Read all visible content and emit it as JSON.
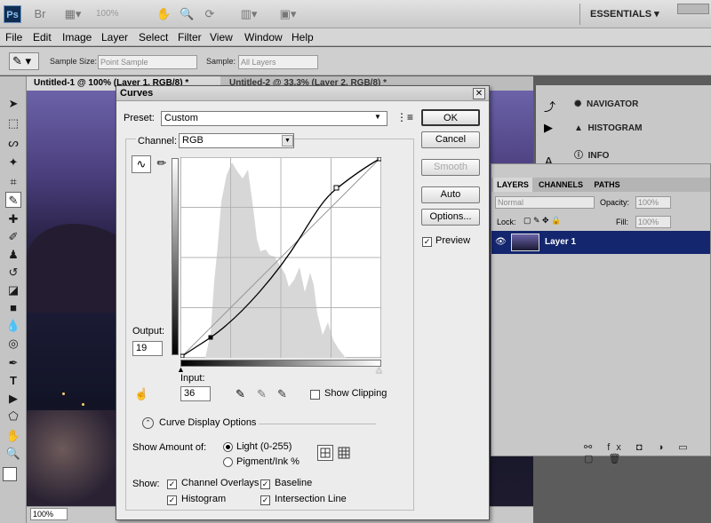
{
  "app": {
    "logo": "Ps",
    "zoom": "100%",
    "workspace": "ESSENTIALS",
    "menus": [
      "File",
      "Edit",
      "Image",
      "Layer",
      "Select",
      "Filter",
      "View",
      "Window",
      "Help"
    ]
  },
  "options_bar": {
    "sample_size_label": "Sample Size:",
    "sample_size_value": "Point Sample",
    "sample_label": "Sample:",
    "sample_value": "All Layers"
  },
  "tabs": [
    {
      "label": "Untitled-1 @ 100% (Layer 1, RGB/8) *"
    },
    {
      "label": "Untitled-2 @ 33.3% (Layer 2, RGB/8) *"
    }
  ],
  "status": {
    "zoom": "100%"
  },
  "right_panels": {
    "navigator": "NAVIGATOR",
    "histogram": "HISTOGRAM",
    "info": "INFO"
  },
  "layers": {
    "tabs": [
      "LAYERS",
      "CHANNELS",
      "PATHS"
    ],
    "blend_mode": "Normal",
    "opacity_label": "Opacity:",
    "opacity": "100%",
    "lock_label": "Lock:",
    "fill_label": "Fill:",
    "fill": "100%",
    "layer_name": "Layer 1",
    "footer_icons": "fx"
  },
  "curves": {
    "title": "Curves",
    "preset_label": "Preset:",
    "preset_value": "Custom",
    "channel_label": "Channel:",
    "channel_value": "RGB",
    "buttons": {
      "ok": "OK",
      "cancel": "Cancel",
      "smooth": "Smooth",
      "auto": "Auto",
      "options": "Options..."
    },
    "preview_label": "Preview",
    "preview_checked": true,
    "output_label": "Output:",
    "output_value": "19",
    "input_label": "Input:",
    "input_value": "36",
    "show_clipping_label": "Show Clipping",
    "curve_display_options": "Curve Display Options",
    "show_amount_label": "Show Amount of:",
    "light_label": "Light  (0-255)",
    "pigment_label": "Pigment/Ink %",
    "show_label": "Show:",
    "channel_overlays": "Channel Overlays",
    "baseline": "Baseline",
    "histogram": "Histogram",
    "intersection_line": "Intersection Line",
    "control_points": [
      [
        0,
        0
      ],
      [
        36,
        19
      ],
      [
        200,
        220
      ],
      [
        255,
        255
      ]
    ]
  }
}
